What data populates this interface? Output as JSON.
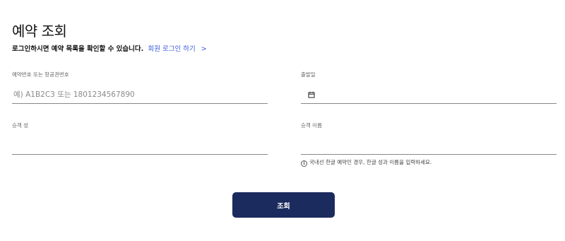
{
  "page": {
    "title": "예약 조회",
    "subtitle_text": "로그인하시면 예약 목록을 확인할 수 있습니다.",
    "login_link": "회원 로그인 하기",
    "login_chevron": ">"
  },
  "form": {
    "reservation": {
      "label": "예약번호 또는 항공권번호",
      "placeholder": "예) A1B2C3 또는 1801234567890",
      "value": ""
    },
    "departure_date": {
      "label": "출발일",
      "value": "",
      "icon": "calendar-icon"
    },
    "last_name": {
      "label": "승객 성",
      "value": ""
    },
    "first_name": {
      "label": "승객 이름",
      "value": ""
    },
    "hint": {
      "icon_glyph": "i",
      "text": "국내선 한글 예약인 경우, 한글 성과 이름을 입력하세요."
    },
    "submit_label": "조회"
  },
  "colors": {
    "accent": "#1c2b5e",
    "link": "#3b5bdb"
  }
}
